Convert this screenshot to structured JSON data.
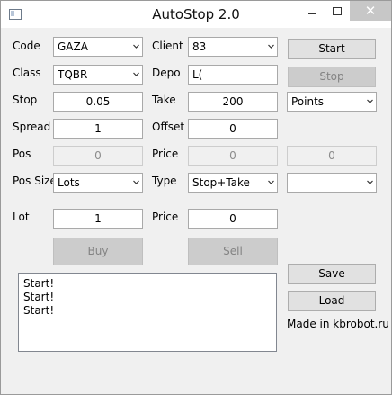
{
  "window": {
    "title": "AutoStop 2.0",
    "close_glyph": "✕"
  },
  "labels": {
    "code": "Code",
    "client": "Client",
    "class": "Class",
    "depo": "Depo",
    "stop": "Stop",
    "take": "Take",
    "spread": "Spread",
    "offset": "Offset",
    "pos": "Pos",
    "price": "Price",
    "pos_size": "Pos Size",
    "type": "Type",
    "lot": "Lot",
    "price2": "Price"
  },
  "fields": {
    "code": "GAZA",
    "client": "83",
    "class": "TQBR",
    "depo": "L(",
    "stop": "0.05",
    "take": "200",
    "take_unit": "Points",
    "spread": "1",
    "offset": "0",
    "pos": "0",
    "price": "0",
    "extra": "0",
    "pos_size": "Lots",
    "type": "Stop+Take",
    "type_extra": "",
    "lot": "1",
    "order_price": "0"
  },
  "buttons": {
    "start": "Start",
    "stop": "Stop",
    "buy": "Buy",
    "sell": "Sell",
    "save": "Save",
    "load": "Load"
  },
  "log": {
    "lines": [
      "Start!",
      "Start!",
      "Start!"
    ]
  },
  "footer": {
    "credit": "Made in kbrobot.ru"
  }
}
